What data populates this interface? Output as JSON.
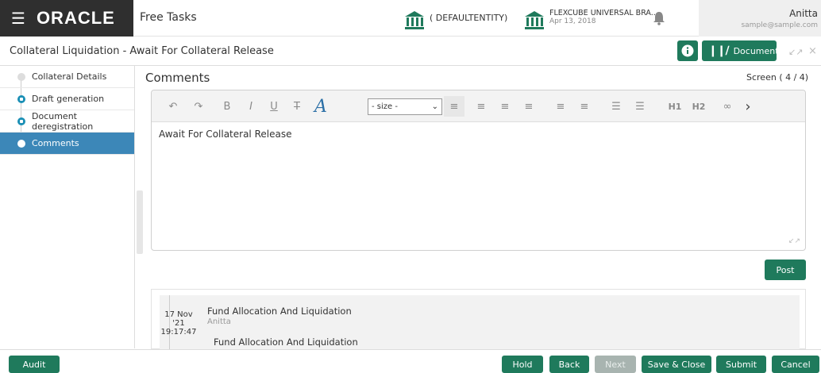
{
  "header": {
    "brand": "ORACLE",
    "module": "Free Tasks",
    "entity": "( DEFAULTENTITY)",
    "branch_name": "FLEXCUBE UNIVERSAL BRA...",
    "branch_date": "Apr 13, 2018",
    "user_name": "Anitta",
    "user_email": "sample@sample.com"
  },
  "titlebar": {
    "title": "Collateral Liquidation - Await For Collateral Release",
    "documents_label": "Documents"
  },
  "sidebar": {
    "items": [
      {
        "label": "Collateral Details"
      },
      {
        "label": "Draft generation"
      },
      {
        "label": "Document deregistration"
      },
      {
        "label": "Comments"
      }
    ]
  },
  "main": {
    "section_title": "Comments",
    "screen_number": "Screen ( 4 / 4)",
    "size_select_value": "- size -",
    "editor_text": "Await For Collateral Release",
    "post_label": "Post",
    "toolbar": {
      "bold": "B",
      "italic": "I",
      "underline": "U",
      "strike": "T",
      "font": "A",
      "h1": "H1",
      "h2": "H2"
    }
  },
  "comments": [
    {
      "date_day": "17 Nov",
      "date_year": "'21",
      "date_time": "19:17:47",
      "title": "Fund Allocation And Liquidation",
      "author": "Anitta",
      "text": "Fund Allocation And Liquidation"
    }
  ],
  "footer": {
    "audit": "Audit",
    "hold": "Hold",
    "back": "Back",
    "next": "Next",
    "save_close": "Save & Close",
    "submit": "Submit",
    "cancel": "Cancel"
  },
  "colors": {
    "accent": "#1f7a5c",
    "sidebar_active": "#3c87b8",
    "step_icon": "#1a8fb5",
    "brand_bg": "#2f2f2f"
  }
}
